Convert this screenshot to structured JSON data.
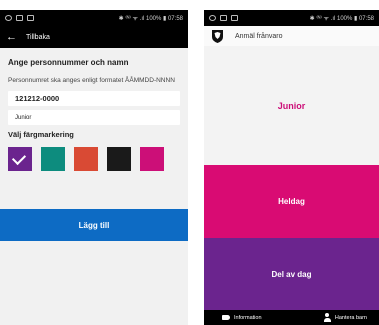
{
  "left": {
    "status": {
      "icons": [
        "clock-icon",
        "image-icon",
        "lock-icon"
      ],
      "right_text": "✱ ⁽ᴺ⁾ ᯤ .ıl 100% ▮ 07:58",
      "time": "07:58",
      "battery": "100%"
    },
    "header": {
      "back_label": "Tillbaka"
    },
    "form": {
      "heading": "Ange personnummer och namn",
      "hint": "Personnumret ska anges enligt formatet ÅÅMMDD-NNNN",
      "personnummer_value": "121212-0000",
      "name_value": "Junior",
      "color_label": "Välj färgmarkering"
    },
    "swatches": [
      {
        "color": "#6b248e",
        "selected": true
      },
      {
        "color": "#0d8c7e",
        "selected": false
      },
      {
        "color": "#d94a34",
        "selected": false
      },
      {
        "color": "#1a1a1a",
        "selected": false
      },
      {
        "color": "#cc0f78",
        "selected": false
      }
    ],
    "add_button": "Lägg till"
  },
  "right": {
    "status": {
      "right_text": "✱ ⁽ᴺ⁾ ᯤ .ıl 100% ▮ 07:58",
      "time": "07:58",
      "battery": "100%"
    },
    "header": {
      "title": "Anmäl frånvaro"
    },
    "child_name": "Junior",
    "buttons": {
      "full_day": "Heldag",
      "part_day": "Del av dag"
    },
    "nav": {
      "information": "Information",
      "manage_children": "Hantera barn"
    },
    "colors": {
      "accent_pink": "#d90b73",
      "accent_purple": "#6b248e"
    }
  }
}
